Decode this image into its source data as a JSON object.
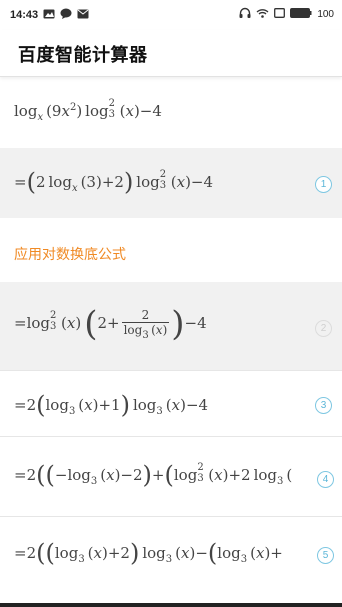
{
  "status_bar": {
    "time": "14:43",
    "battery": "100",
    "left_icons": [
      "image-icon",
      "chat-bubble-icon",
      "mail-icon"
    ],
    "right_icons": [
      "headphones-icon",
      "wifi-icon",
      "screen-icon",
      "battery-icon"
    ]
  },
  "app": {
    "title": "百度智能计算器"
  },
  "section_label": "应用对数换底公式",
  "steps": [
    {
      "id": "problem",
      "badge": ""
    },
    {
      "id": "step1",
      "badge": "1"
    },
    {
      "id": "step2",
      "badge": "2"
    },
    {
      "id": "step3",
      "badge": "3"
    },
    {
      "id": "step4",
      "badge": "4"
    },
    {
      "id": "step5",
      "badge": "5"
    }
  ],
  "colors": {
    "accent_orange": "#f08a24",
    "badge_blue": "#5cb6d8",
    "gray_row": "#f1f1f1"
  }
}
